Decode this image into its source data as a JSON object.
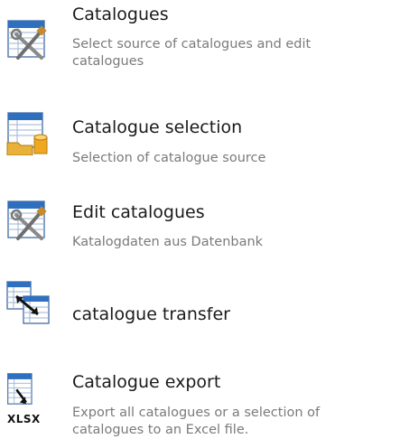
{
  "items": [
    {
      "title": "Catalogues",
      "description": "Select source of catalogues and edit catalogues",
      "icon": "catalogue-tools-icon"
    },
    {
      "title": "Catalogue selection",
      "description": "Selection of catalogue source",
      "icon": "catalogue-database-icon"
    },
    {
      "title": "Edit catalogues",
      "description": "Katalogdaten aus Datenbank",
      "icon": "catalogue-tools-icon"
    },
    {
      "title": "catalogue transfer",
      "description": "",
      "icon": "catalogue-transfer-icon"
    },
    {
      "title": "Catalogue export",
      "description": "Export all catalogues or a selection of catalogues to an Excel file.",
      "icon": "xlsx-export-icon",
      "icon_text": "XLSX"
    }
  ]
}
